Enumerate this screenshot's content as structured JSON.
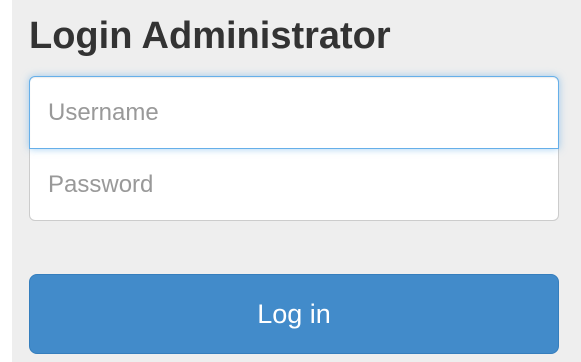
{
  "login": {
    "title": "Login Administrator",
    "username_placeholder": "Username",
    "username_value": "",
    "password_placeholder": "Password",
    "password_value": "",
    "submit_label": "Log in"
  },
  "colors": {
    "page_background": "#eeeeee",
    "button_background": "#428bca",
    "focus_border": "#66afe9"
  }
}
